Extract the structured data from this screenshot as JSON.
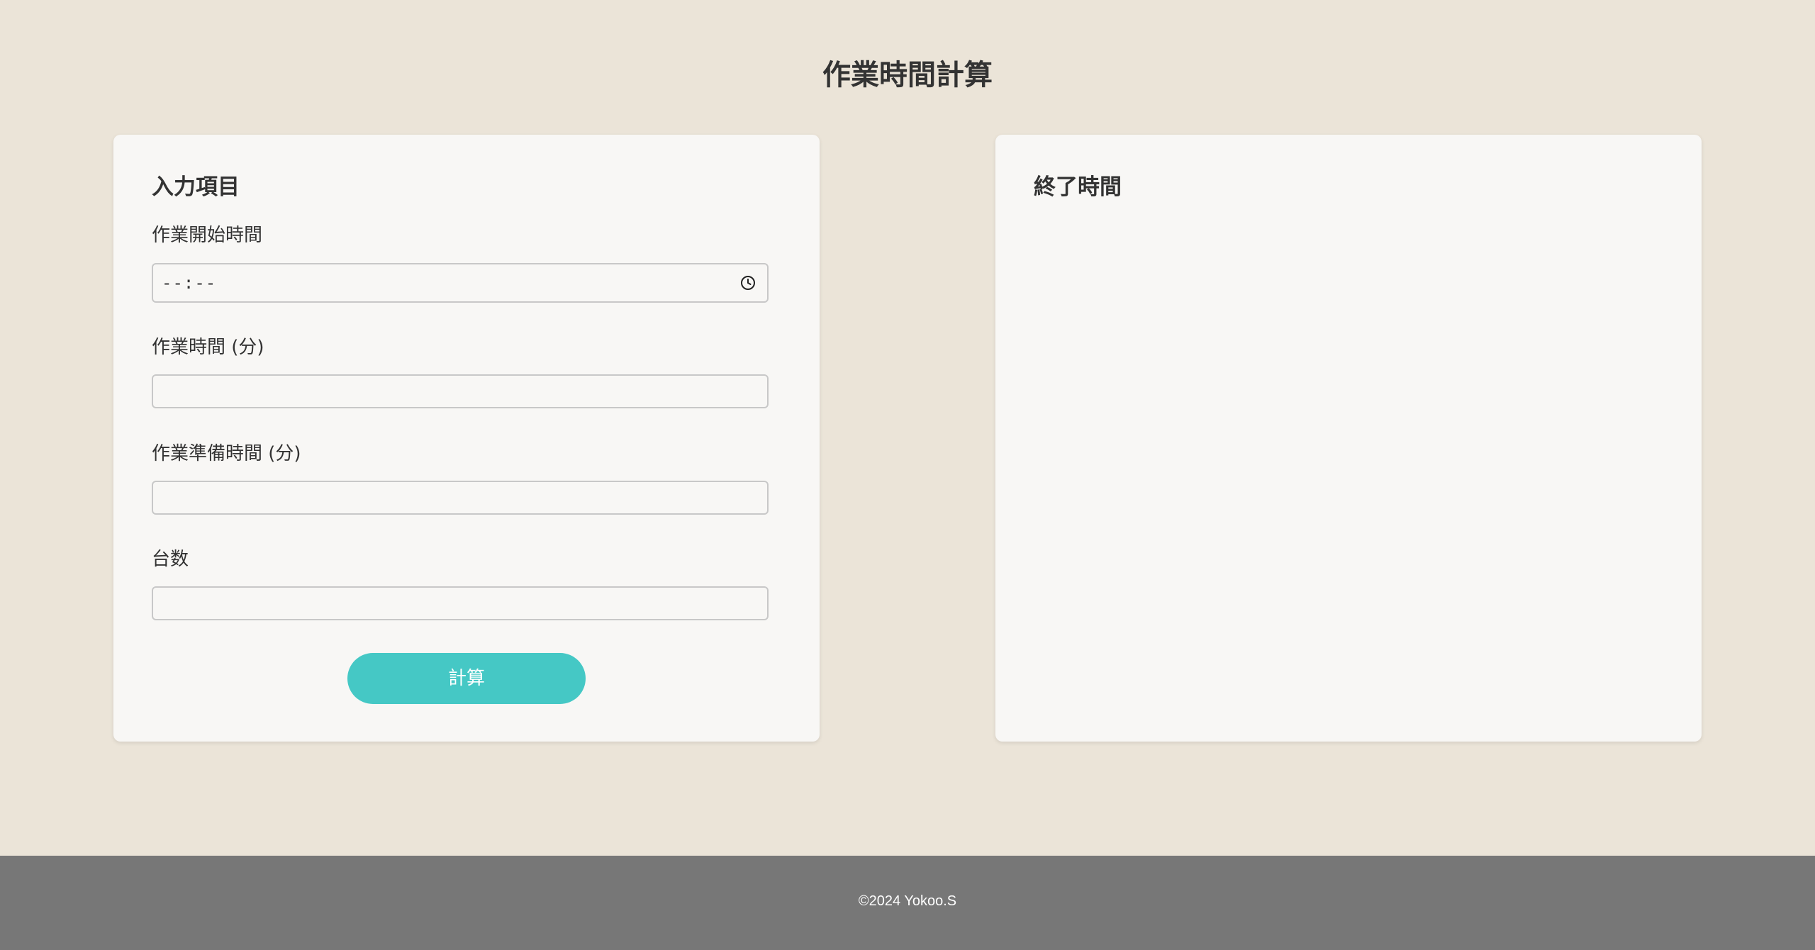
{
  "page": {
    "title": "作業時間計算"
  },
  "input_panel": {
    "heading": "入力項目",
    "start_time": {
      "label": "作業開始時間",
      "value": "",
      "display": "--:--",
      "icon": "clock-icon"
    },
    "work_minutes": {
      "label": "作業時間 (分)",
      "value": ""
    },
    "prep_minutes": {
      "label": "作業準備時間 (分)",
      "value": ""
    },
    "units": {
      "label": "台数",
      "value": ""
    },
    "calculate_label": "計算"
  },
  "result_panel": {
    "heading": "終了時間"
  },
  "footer": {
    "copyright": "©2024 Yokoo.S"
  },
  "colors": {
    "background": "#ebe4d8",
    "card": "#f8f7f5",
    "accent": "#45c8c5",
    "footer": "#777777",
    "text": "#333333"
  }
}
